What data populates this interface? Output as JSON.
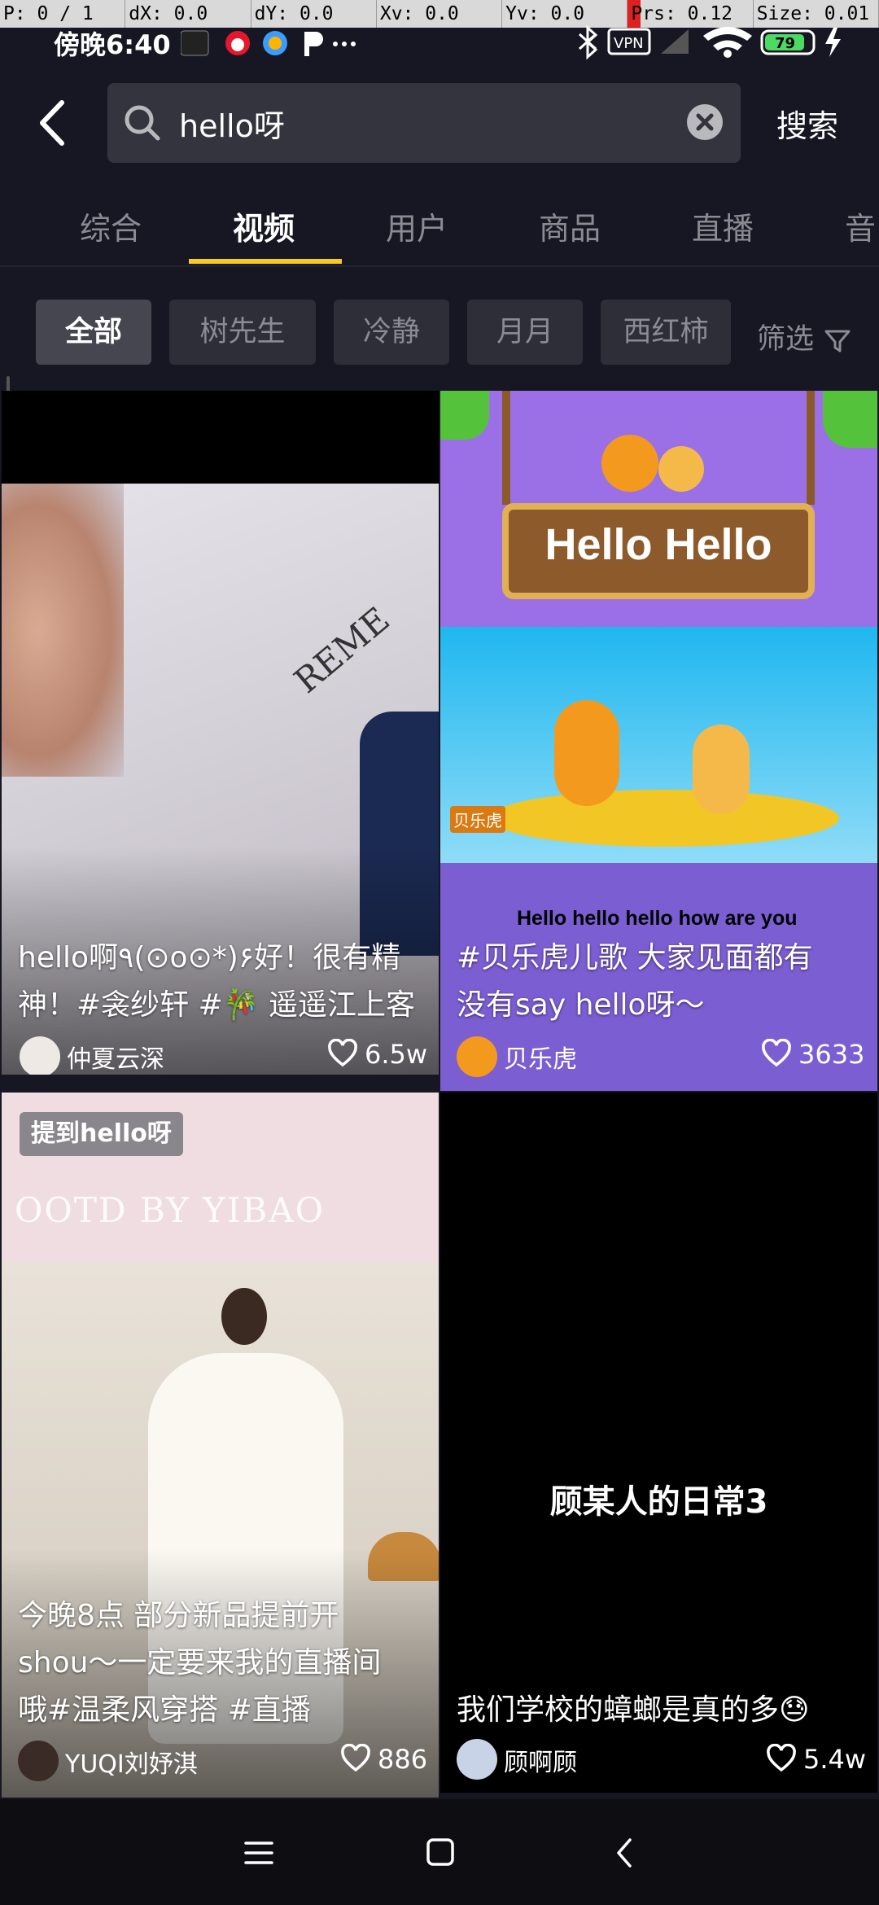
{
  "debug": {
    "pointer": "P: 0 / 1",
    "dx": "dX: 0.0",
    "dy": "dY: 0.0",
    "xv": "Xv: 0.0",
    "yv": "Yv: 0.0",
    "prs": "Prs: 0.12",
    "size": "Size: 0.01"
  },
  "status": {
    "time": "傍晚6:40",
    "battery": "79",
    "vpn": "VPN"
  },
  "search": {
    "query": "hello呀",
    "button_label": "搜索"
  },
  "tabs": [
    {
      "label": "综合"
    },
    {
      "label": "视频",
      "active": true
    },
    {
      "label": "用户"
    },
    {
      "label": "商品"
    },
    {
      "label": "直播"
    },
    {
      "label": "音"
    }
  ],
  "chips": [
    {
      "label": "全部",
      "active": true
    },
    {
      "label": "树先生"
    },
    {
      "label": "冷静"
    },
    {
      "label": "月月"
    },
    {
      "label": "西红柿"
    }
  ],
  "filter_label": "筛选",
  "videos": [
    {
      "caption_l1": "hello啊٩(⊙o⊙*)۶好！很有精",
      "caption_l2": "神！#衾纱轩 #🎋 遥遥江上客",
      "author": "仲夏云深",
      "likes": "6.5w",
      "thumb_text": "REME"
    },
    {
      "caption_l1": "#贝乐虎儿歌 大家见面都有",
      "caption_l2": "没有say hello呀～",
      "author": "贝乐虎",
      "likes": "3633",
      "thumb_title": "Hello Hello",
      "thumb_subtitle": "Hello hello hello how are you",
      "thumb_brand": "贝乐虎"
    },
    {
      "badge": "提到hello呀",
      "thumb_text": "OOTD BY YIBAO",
      "caption_l1": "今晚8点 部分新品提前开",
      "caption_l2": "shou～一定要来我的直播间",
      "caption_l3": "哦#温柔风穿搭 #直播",
      "author": "YUQI刘妤淇",
      "likes": "886"
    },
    {
      "thumb_text": "顾某人的日常3",
      "caption_l1": "我们学校的蟑螂是真的多😓",
      "author": "顾啊顾",
      "likes": "5.4w"
    }
  ],
  "colors": {
    "background": "#161722",
    "accent": "#fac922",
    "muted": "#8a8b93"
  }
}
